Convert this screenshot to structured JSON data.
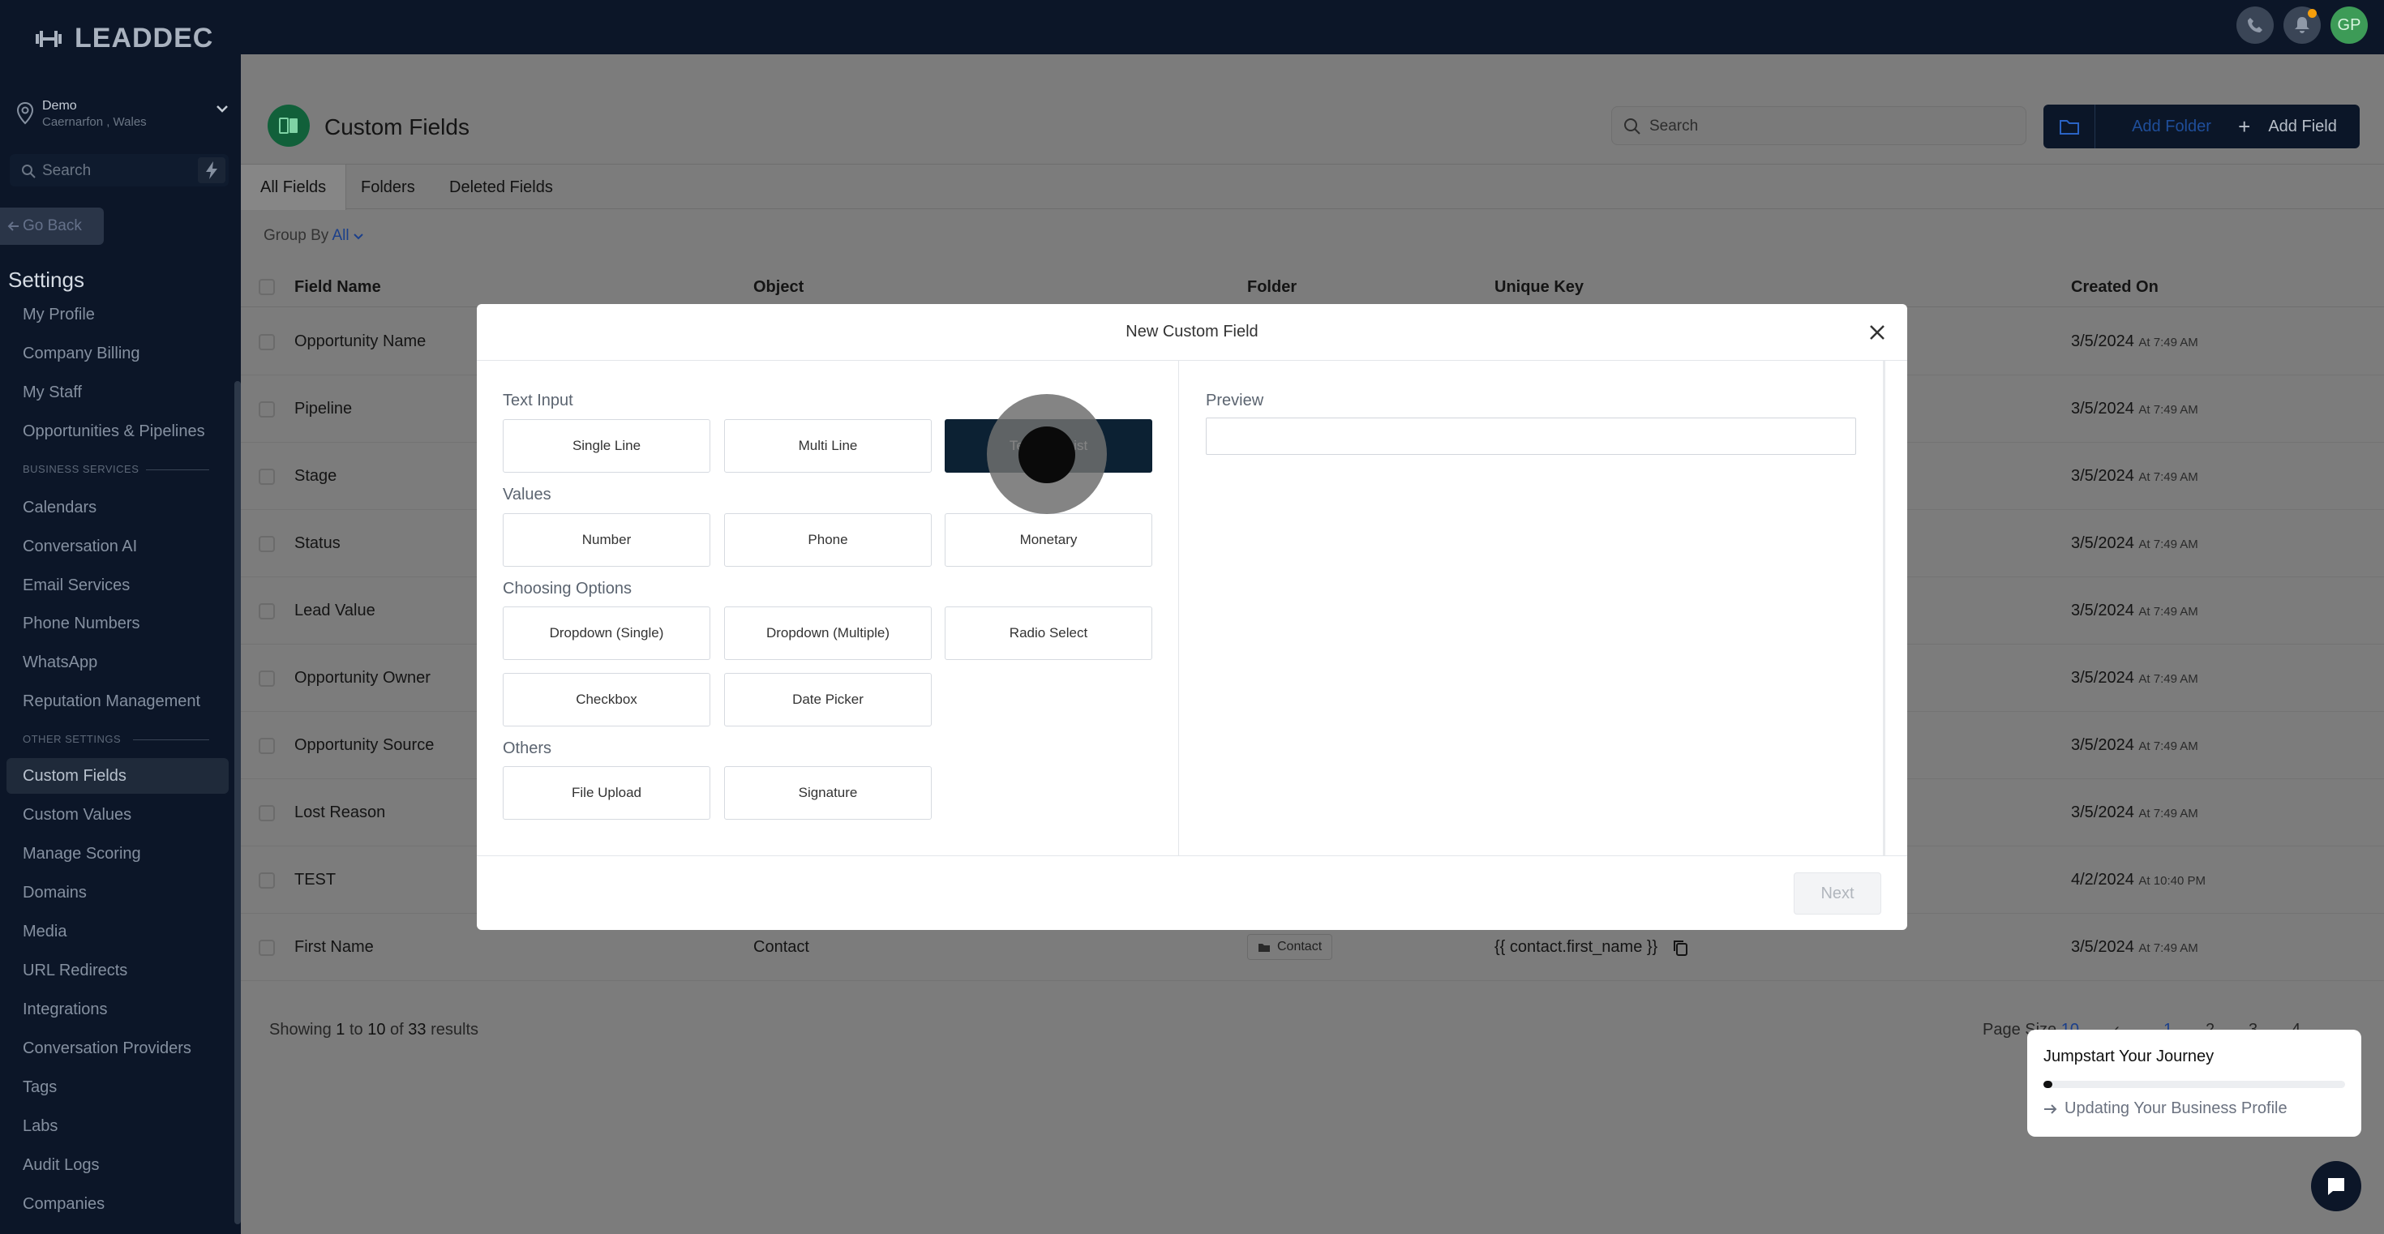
{
  "brand": {
    "logo_text": "LEADDEC"
  },
  "topbar": {
    "avatar_initials": "GP"
  },
  "location": {
    "name": "Demo",
    "place": "Caernarfon , Wales"
  },
  "sidebar": {
    "search_placeholder": "Search",
    "go_back": "Go Back",
    "settings_title": "Settings",
    "items": [
      "My Profile",
      "Company Billing",
      "My Staff",
      "Opportunities & Pipelines"
    ],
    "section_business": "BUSINESS SERVICES",
    "business_items": [
      "Calendars",
      "Conversation AI",
      "Email Services",
      "Phone Numbers",
      "WhatsApp",
      "Reputation Management"
    ],
    "section_other": "OTHER SETTINGS",
    "other_items": [
      "Custom Fields",
      "Custom Values",
      "Manage Scoring",
      "Domains",
      "Media",
      "URL Redirects",
      "Integrations",
      "Conversation Providers",
      "Tags",
      "Labs",
      "Audit Logs",
      "Companies"
    ],
    "active_item": "Custom Fields"
  },
  "page": {
    "title": "Custom Fields",
    "search_placeholder": "Search",
    "add_folder": "Add Folder",
    "add_field": "Add Field",
    "tabs": [
      "All Fields",
      "Folders",
      "Deleted Fields"
    ],
    "group_by_label": "Group By",
    "group_by_value": "All"
  },
  "table": {
    "headers": {
      "field_name": "Field Name",
      "object": "Object",
      "folder": "Folder",
      "unique_key": "Unique Key",
      "created_on": "Created On"
    },
    "rows": [
      {
        "name": "Opportunity Name",
        "date": "3/5/2024",
        "time": "At 7:49 AM"
      },
      {
        "name": "Pipeline",
        "date": "3/5/2024",
        "time": "At 7:49 AM"
      },
      {
        "name": "Stage",
        "date": "3/5/2024",
        "time": "At 7:49 AM"
      },
      {
        "name": "Status",
        "date": "3/5/2024",
        "time": "At 7:49 AM"
      },
      {
        "name": "Lead Value",
        "date": "3/5/2024",
        "time": "At 7:49 AM"
      },
      {
        "name": "Opportunity Owner",
        "date": "3/5/2024",
        "time": "At 7:49 AM"
      },
      {
        "name": "Opportunity Source",
        "date": "3/5/2024",
        "time": "At 7:49 AM"
      },
      {
        "name": "Lost Reason",
        "date": "3/5/2024",
        "time": "At 7:49 AM"
      },
      {
        "name": "TEST",
        "date": "4/2/2024",
        "time": "At 10:40 PM"
      },
      {
        "name": "First Name",
        "object": "Contact",
        "folder": "Contact",
        "key": "{{ contact.first_name }}",
        "date": "3/5/2024",
        "time": "At 7:49 AM"
      }
    ],
    "showing": {
      "prefix": "Showing",
      "from": "1",
      "to_word": "to",
      "to": "10",
      "of_word": "of",
      "total": "33",
      "suffix": "results"
    },
    "page_size_label": "Page Size",
    "page_size_value": "10",
    "pages": [
      "1",
      "2",
      "3",
      "4"
    ]
  },
  "modal": {
    "title": "New Custom Field",
    "groups": {
      "text_input": "Text Input",
      "values": "Values",
      "choosing_options": "Choosing Options",
      "others": "Others"
    },
    "options": {
      "single_line": "Single Line",
      "multi_line": "Multi Line",
      "text_box_list": "Text Box List",
      "number": "Number",
      "phone": "Phone",
      "monetary": "Monetary",
      "dropdown_single": "Dropdown (Single)",
      "dropdown_multiple": "Dropdown (Multiple)",
      "radio_select": "Radio Select",
      "checkbox": "Checkbox",
      "date_picker": "Date Picker",
      "file_upload": "File Upload",
      "signature": "Signature"
    },
    "selected": "text_box_list",
    "preview_label": "Preview",
    "next": "Next"
  },
  "jumpstart": {
    "title": "Jumpstart Your Journey",
    "step": "Updating Your Business Profile",
    "progress": 0.03
  },
  "colors": {
    "sidebar_bg": "#0c1628",
    "accent_green": "#3d9b57",
    "selected_option": "#0c2133"
  }
}
